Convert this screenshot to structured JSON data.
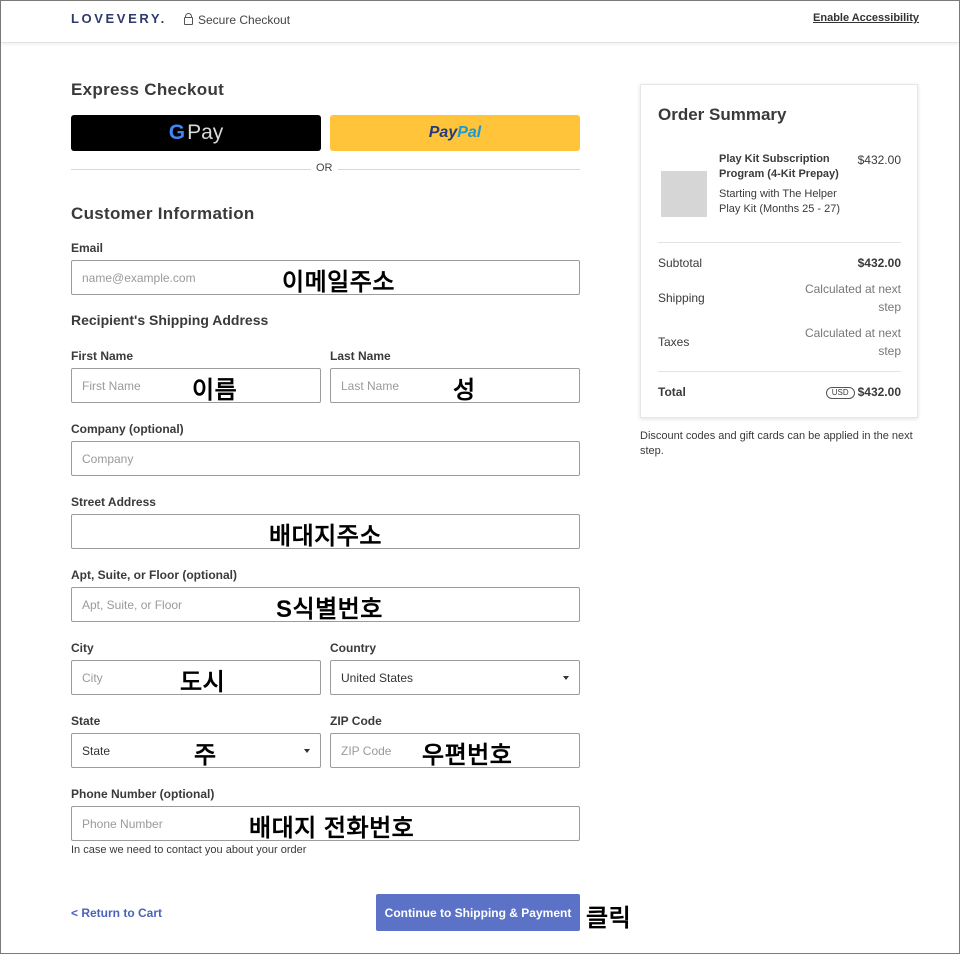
{
  "header": {
    "logo": "LOVEVERY.",
    "secure_checkout": "Secure Checkout",
    "enable_accessibility": "Enable Accessibility"
  },
  "express": {
    "title": "Express Checkout",
    "gpay_g": "G",
    "gpay_pay": "Pay",
    "paypal_pay": "Pay",
    "paypal_pal": "Pal",
    "or": "OR"
  },
  "customer": {
    "title": "Customer Information",
    "email_label": "Email",
    "email_placeholder": "name@example.com",
    "email_note": "이메일주소"
  },
  "shipping": {
    "title": "Recipient's Shipping Address",
    "first_name_label": "First Name",
    "first_name_placeholder": "First Name",
    "first_name_note": "이름",
    "last_name_label": "Last Name",
    "last_name_placeholder": "Last Name",
    "last_name_note": "성",
    "company_label": "Company (optional)",
    "company_placeholder": "Company",
    "street_label": "Street Address",
    "street_note": "배대지주소",
    "apt_label": "Apt, Suite, or Floor (optional)",
    "apt_placeholder": "Apt, Suite, or Floor",
    "apt_note": "S식별번호",
    "city_label": "City",
    "city_placeholder": "City",
    "city_note": "도시",
    "country_label": "Country",
    "country_value": "United States",
    "state_label": "State",
    "state_value": "State",
    "state_note": "주",
    "zip_label": "ZIP Code",
    "zip_placeholder": "ZIP Code",
    "zip_note": "우편번호",
    "phone_label": "Phone Number (optional)",
    "phone_placeholder": "Phone Number",
    "phone_note": "배대지 전화번호",
    "phone_hint": "In case we need to contact you about your order"
  },
  "actions": {
    "return_to_cart": "< Return to Cart",
    "continue": "Continue to Shipping & Payment",
    "continue_note": "클릭"
  },
  "summary": {
    "title": "Order Summary",
    "product_name": "Play Kit Subscription Program (4-Kit Prepay)",
    "product_sub": "Starting with The Helper Play Kit (Months 25 - 27)",
    "product_price": "$432.00",
    "subtotal_label": "Subtotal",
    "subtotal_value": "$432.00",
    "shipping_label": "Shipping",
    "shipping_value": "Calculated at next step",
    "taxes_label": "Taxes",
    "taxes_value": "Calculated at next step",
    "total_label": "Total",
    "currency": "USD",
    "total_value": "$432.00"
  },
  "discount_note": "Discount codes and gift cards can be applied in the next step."
}
